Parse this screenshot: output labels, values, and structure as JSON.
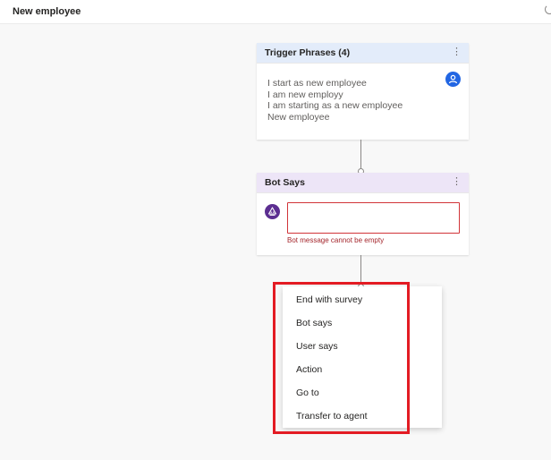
{
  "header": {
    "title": "New employee"
  },
  "trigger_card": {
    "title": "Trigger Phrases (4)",
    "more": "⋮",
    "phrases": [
      "I start as new employee",
      "I am new employy",
      "I am starting as a new employee",
      "New employee"
    ]
  },
  "bot_card": {
    "title": "Bot Says",
    "more": "⋮",
    "message_value": "",
    "error": "Bot message cannot be empty"
  },
  "menu": {
    "items": [
      "End with survey",
      "Bot says",
      "User says",
      "Action",
      "Go to",
      "Transfer to agent"
    ]
  },
  "colors": {
    "accent": "#2266e3",
    "bot": "#5c2e91",
    "error": "#a4262c",
    "highlight": "#e31b23"
  },
  "icons": {
    "user": "user-icon",
    "bot": "bot-icon",
    "more": "more-options-icon",
    "loading": "loading-spinner-icon"
  }
}
